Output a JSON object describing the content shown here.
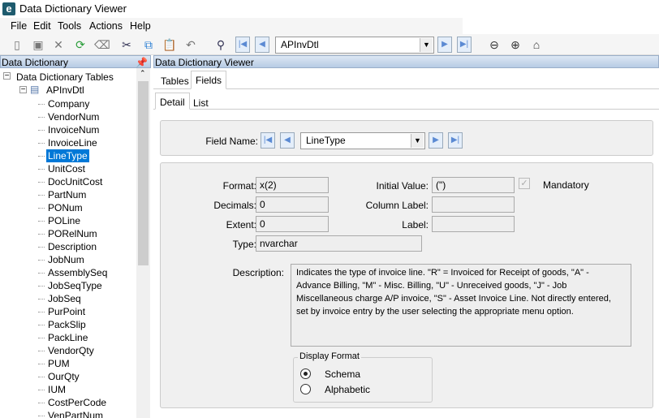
{
  "window": {
    "title": "Data Dictionary Viewer",
    "logo": "e"
  },
  "menu": [
    "File",
    "Edit",
    "Tools",
    "Actions",
    "Help"
  ],
  "toolbar": {
    "table_combo": "APInvDtl",
    "icons": [
      "new-icon",
      "save-icon",
      "delete-icon",
      "refresh-icon",
      "clear-icon",
      "cut-icon",
      "copy-icon",
      "paste-icon",
      "undo-icon",
      "search-icon",
      "first-icon",
      "prev-icon",
      "next-icon",
      "last-icon",
      "back-icon",
      "forward-icon",
      "home-icon"
    ]
  },
  "left_panel": {
    "title": "Data Dictionary",
    "root": "Data Dictionary Tables",
    "table": "APInvDtl",
    "fields": [
      "Company",
      "VendorNum",
      "InvoiceNum",
      "InvoiceLine",
      "LineType",
      "UnitCost",
      "DocUnitCost",
      "PartNum",
      "PONum",
      "POLine",
      "PORelNum",
      "Description",
      "JobNum",
      "AssemblySeq",
      "JobSeqType",
      "JobSeq",
      "PurPoint",
      "PackSlip",
      "PackLine",
      "VendorQty",
      "PUM",
      "OurQty",
      "IUM",
      "CostPerCode",
      "VenPartNum"
    ],
    "selected": "LineType"
  },
  "right_panel": {
    "title": "Data Dictionary Viewer",
    "tabs": [
      "Tables",
      "Fields"
    ],
    "subtabs": [
      "Detail",
      "List"
    ],
    "field_name_label": "Field Name:",
    "field_name": "LineType",
    "format_label": "Format:",
    "format": "x(2)",
    "decimals_label": "Decimals:",
    "decimals": "0",
    "extent_label": "Extent:",
    "extent": "0",
    "type_label": "Type:",
    "type": "nvarchar",
    "initial_value_label": "Initial Value:",
    "initial_value": "(\")",
    "column_label_label": "Column Label:",
    "column_label": "",
    "label_label": "Label:",
    "label": "",
    "mandatory_label": "Mandatory",
    "description_label": "Description:",
    "description": "Indicates the type of invoice line. \"R\" = Invoiced for Receipt of goods, \"A\" - Advance Billing,  \"M\" - Misc. Billing, \"U\" - Unreceived goods, \"J\" - Job Miscellaneous charge A/P invoice, \"S\" - Asset Invoice Line.  Not directly entered, set by invoice entry by the user selecting the appropriate menu option.",
    "display_format_label": "Display Format",
    "display_options": [
      "Schema",
      "Alphabetic"
    ],
    "display_selected": "Schema"
  }
}
